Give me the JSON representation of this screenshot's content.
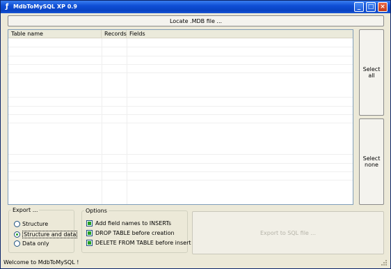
{
  "window": {
    "title": "MdbToMySQL XP 0.9",
    "minimize_glyph": "_",
    "maximize_glyph": "□",
    "close_glyph": "×"
  },
  "toolbar": {
    "locate_label": "Locate .MDB file ..."
  },
  "table": {
    "columns": [
      "Table name",
      "Records",
      "Fields"
    ],
    "rows": []
  },
  "side_buttons": {
    "select_all": "Select all",
    "select_none": "Select none"
  },
  "export_group": {
    "legend": "Export ...",
    "options": [
      {
        "label": "Structure",
        "selected": false
      },
      {
        "label": "Structure and data",
        "selected": true
      },
      {
        "label": "Data only",
        "selected": false
      }
    ]
  },
  "options_group": {
    "legend": "Options",
    "items": [
      {
        "label": "Add field names to INSERTs",
        "checked": true
      },
      {
        "label": "DROP TABLE before creation",
        "checked": true
      },
      {
        "label": "DELETE FROM TABLE before insert",
        "checked": true
      }
    ]
  },
  "export_button": {
    "label": "Export to SQL file ...",
    "enabled": false
  },
  "status": {
    "text": "Welcome to MdbToMySQL !"
  },
  "colors": {
    "titlebar": "#0842c2",
    "window_bg": "#ece9d8",
    "check_fill": "#21a121"
  }
}
